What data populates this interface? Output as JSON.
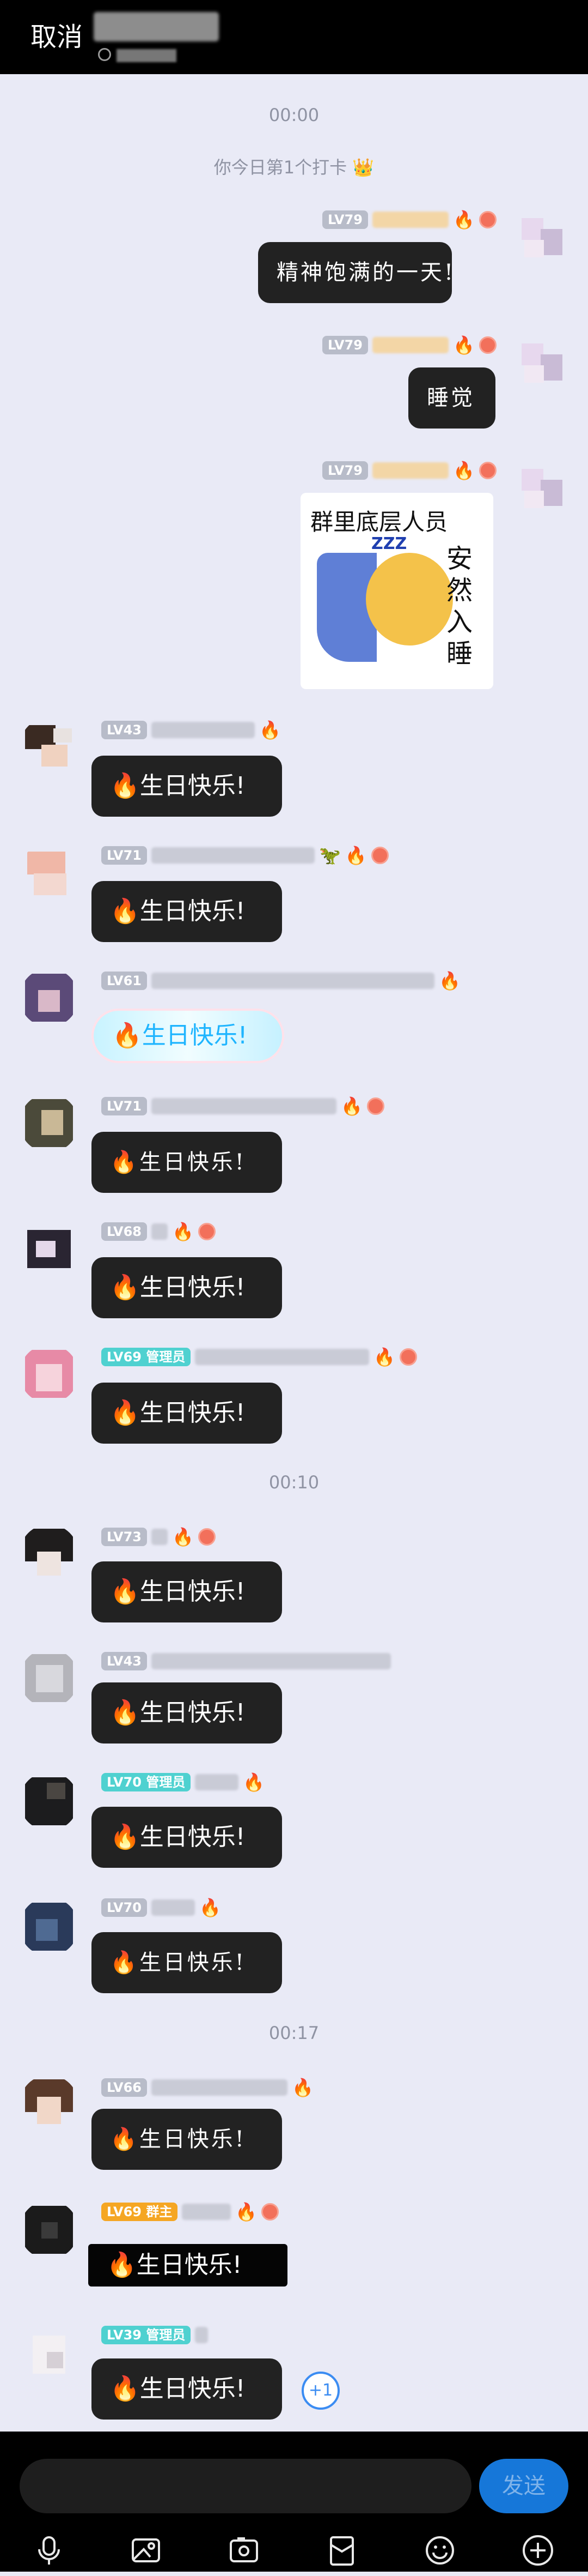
{
  "topbar": {
    "cancel": "取消"
  },
  "messages_section": {
    "time1": "00:00",
    "checkin": "你今日第1个打卡 👑",
    "time2": "00:10",
    "time3": "00:17"
  },
  "mine": [
    {
      "level": "LV79",
      "text": "精神饱满的一天!"
    },
    {
      "level": "LV79",
      "text": "睡觉"
    },
    {
      "level": "LV79",
      "sticker_line1": "群里底层人员",
      "sticker_zzz": "ZZZ",
      "sticker_line2": "安然入睡"
    }
  ],
  "others": [
    {
      "level": "LV43",
      "text": "生日快乐!"
    },
    {
      "level": "LV71",
      "text": "生日快乐!"
    },
    {
      "level": "LV61",
      "text": "生日快乐!"
    },
    {
      "level": "LV71",
      "text": "生日快乐!"
    },
    {
      "level": "LV68",
      "text": "生日快乐!"
    },
    {
      "level": "LV69 管理员",
      "text": "生日快乐!"
    },
    {
      "level": "LV73",
      "text": "生日快乐!"
    },
    {
      "level": "LV43",
      "text": "生日快乐!"
    },
    {
      "level": "LV70 管理员",
      "text": "生日快乐!"
    },
    {
      "level": "LV70",
      "text": "生日快乐!"
    },
    {
      "level": "LV66",
      "text": "生日快乐!"
    },
    {
      "level": "LV69 群主",
      "text": "生日快乐!"
    },
    {
      "level": "LV39 管理员",
      "text": "生日快乐!"
    }
  ],
  "plus_one": "+1",
  "bottom": {
    "send": "发送"
  },
  "icons": {
    "voice": "microphone-icon",
    "image": "image-icon",
    "camera": "camera-icon",
    "redpacket": "red-packet-icon",
    "emoji": "emoji-icon",
    "more": "plus-icon"
  },
  "colors": {
    "accent": "#1677d9",
    "admin_badge": "#4fd1d0",
    "owner_badge": "#f5a623",
    "bubble": "#222222"
  }
}
